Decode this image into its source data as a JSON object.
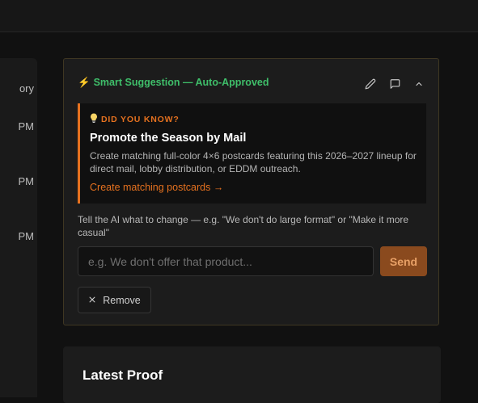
{
  "left_panel": {
    "fragments": [
      "ory",
      "PM",
      "PM",
      "PM"
    ]
  },
  "suggestion": {
    "title": "Smart Suggestion — Auto-Approved",
    "bolt_icon": "⚡",
    "icons": [
      "pencil-icon",
      "comment-icon",
      "chevron-up-icon"
    ],
    "tip": {
      "label": "DID YOU KNOW?",
      "title": "Promote the Season by Mail",
      "body": "Create matching full-color 4×6 postcards featuring this 2026–2027 lineup for direct mail, lobby distribution, or EDDM outreach.",
      "link": "Create matching postcards →"
    },
    "instruction": "Tell the AI what to change — e.g. \"We don't do large format\" or \"Make it more casual\"",
    "input_placeholder": "e.g. We don't offer that product...",
    "input_value": "",
    "send_label": "Send",
    "remove_label": "Remove"
  },
  "latest_proof": {
    "title": "Latest Proof"
  },
  "colors": {
    "accent_orange": "#e5711f",
    "success_green": "#3fbf6a",
    "bolt_yellow": "#f2b51a",
    "send_bg": "#8a4a1e"
  }
}
